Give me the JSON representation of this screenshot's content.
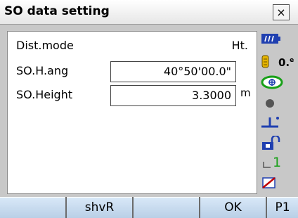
{
  "window": {
    "title": "SO data setting",
    "close_label": "×"
  },
  "form": {
    "dist_mode": {
      "label": "Dist.mode",
      "value": "Ht."
    },
    "so_h_ang": {
      "label": "SO.H.ang",
      "value": "40°50'00.0\""
    },
    "so_height": {
      "label": "SO.Height",
      "value": "3.3000",
      "unit": "m"
    }
  },
  "status": {
    "atmos_correction_label": "0.",
    "atmos_correction_sup": "e",
    "battery_icon": "battery-icon",
    "prism_icon": "prism-constant-icon",
    "target_icon": "target-icon",
    "laser_icon": "laser-dot-icon",
    "tilt_icon": "tilt-icon",
    "lock_icon": "unlock-icon",
    "input_mode": "1",
    "keyboard_icon": "keyboard-icon"
  },
  "softkeys": [
    "",
    "shvR",
    "",
    "OK",
    "P1"
  ]
}
